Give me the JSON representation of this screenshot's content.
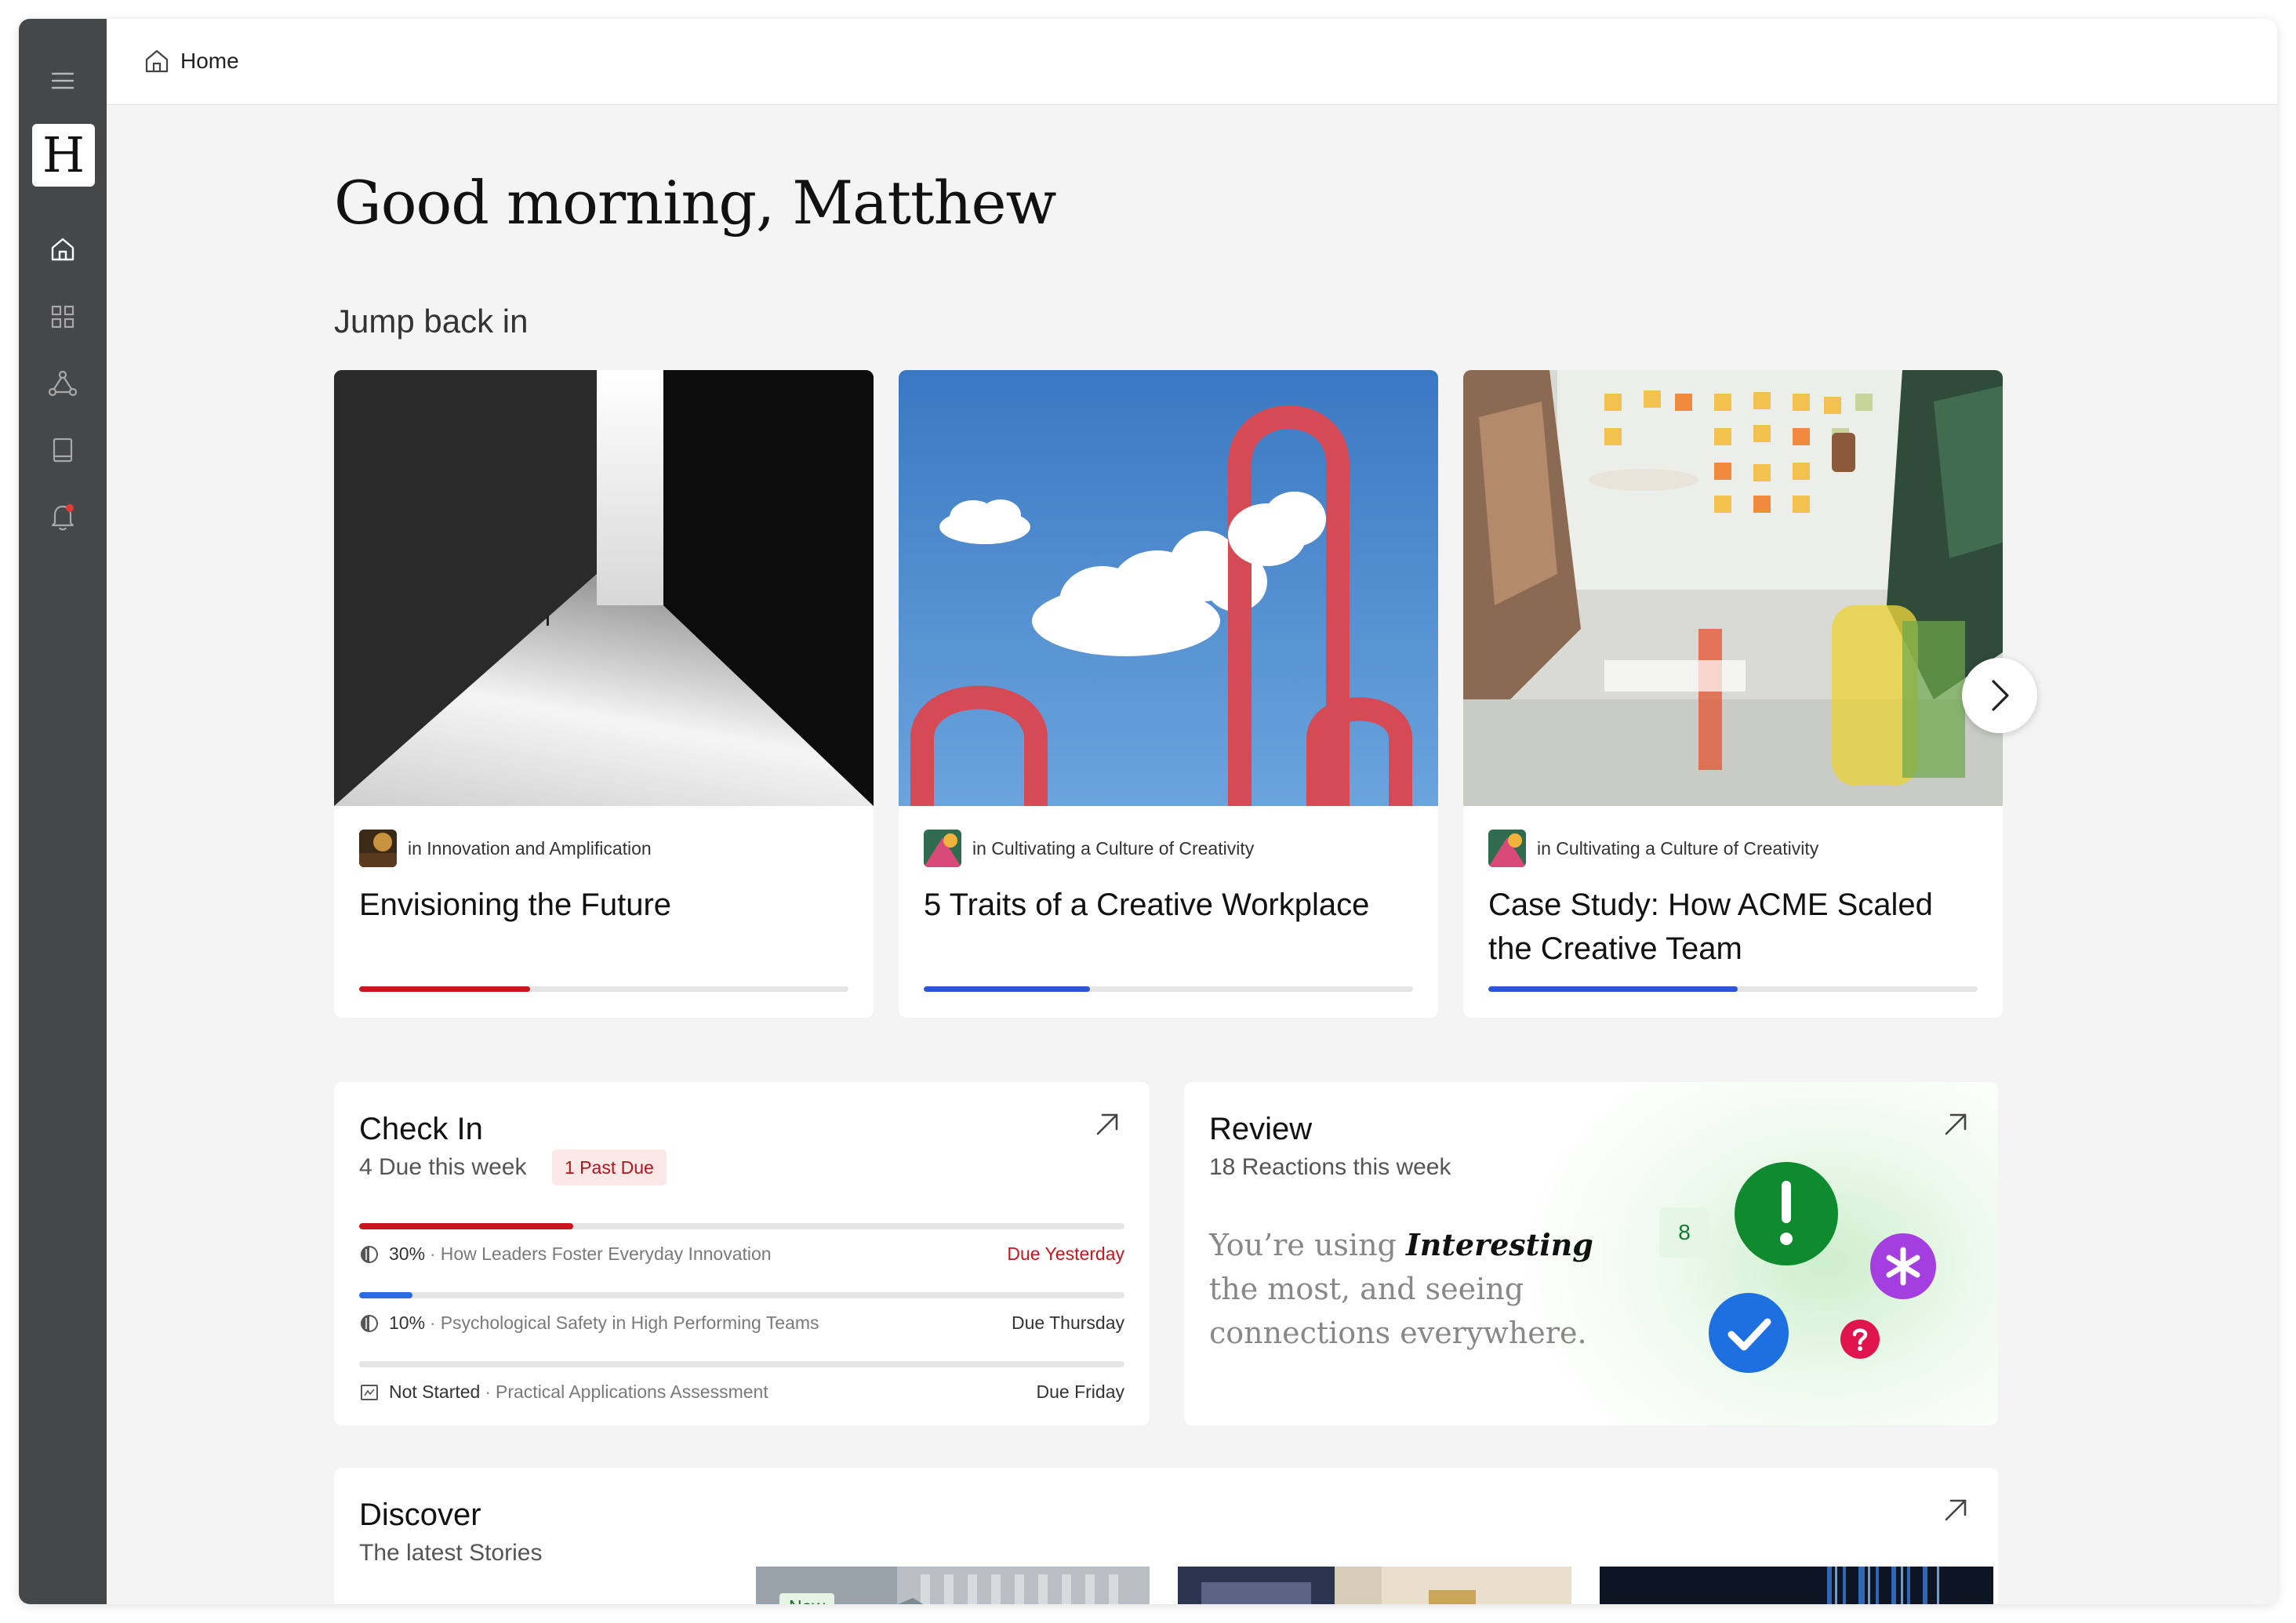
{
  "breadcrumb": {
    "label": "Home"
  },
  "brand": {
    "logo_letter": "H"
  },
  "greeting": "Good morning, Matthew",
  "jump_back_in": {
    "title": "Jump back in",
    "cards": [
      {
        "category": "in Innovation and Amplification",
        "title": "Envisioning the Future",
        "progress": 0.35,
        "progress_color": "#c8151e"
      },
      {
        "category": "in Cultivating a Culture of Creativity",
        "title": "5 Traits of a Creative Workplace",
        "progress": 0.34,
        "progress_color": "#2b54d6"
      },
      {
        "category": "in Cultivating a Culture of Creativity",
        "title": "Case Study: How ACME Scaled the Creative Team",
        "progress": 0.51,
        "progress_color": "#2b54d6"
      }
    ]
  },
  "check_in": {
    "title": "Check In",
    "subtitle": "4 Due this week",
    "badge": "1 Past Due",
    "rows": [
      {
        "status": "30%",
        "name": "How Leaders Foster Everyday Innovation",
        "due": "Due Yesterday",
        "progress": 0.28,
        "color": "#c8151e",
        "late": true
      },
      {
        "status": "10%",
        "name": "Psychological Safety in High Performing Teams",
        "due": "Due Thursday",
        "progress": 0.07,
        "color": "#2b6be4",
        "late": false
      },
      {
        "status": "Not Started",
        "name": "Practical Applications Assessment",
        "due": "Due Friday",
        "progress": 0,
        "color": "#2b6be4",
        "late": false
      }
    ]
  },
  "review": {
    "title": "Review",
    "subtitle": "18 Reactions this week",
    "quote_before": "You’re using ",
    "quote_emphasis": "Interesting",
    "quote_after": " the most, and seeing connections everywhere.",
    "count_badge": "8"
  },
  "discover": {
    "title": "Discover",
    "subtitle": "The latest Stories",
    "new_tag": "New"
  }
}
